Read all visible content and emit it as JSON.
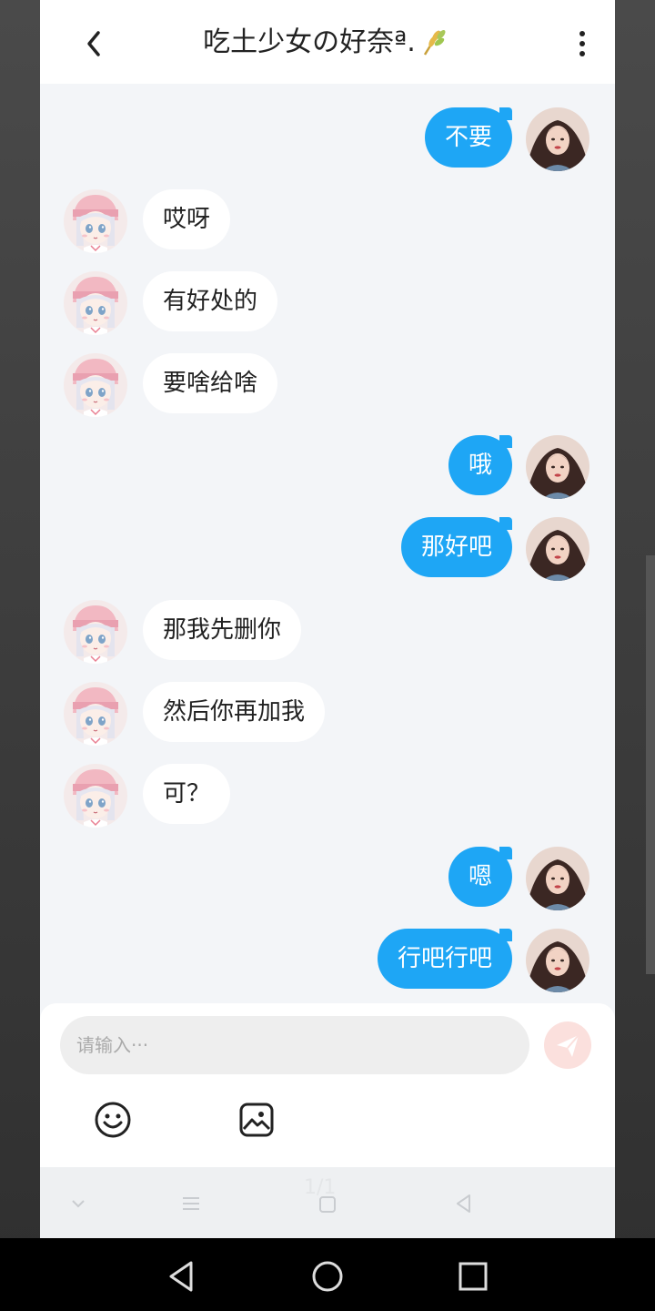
{
  "header": {
    "title": "吃土少女の好奈ª."
  },
  "messages": [
    {
      "side": "right",
      "text": "不要"
    },
    {
      "side": "left",
      "text": "哎呀"
    },
    {
      "side": "left",
      "text": "有好处的"
    },
    {
      "side": "left",
      "text": "要啥给啥"
    },
    {
      "side": "right",
      "text": "哦"
    },
    {
      "side": "right",
      "text": "那好吧"
    },
    {
      "side": "left",
      "text": "那我先删你"
    },
    {
      "side": "left",
      "text": "然后你再加我"
    },
    {
      "side": "left",
      "text": "可？"
    },
    {
      "side": "right",
      "text": "嗯"
    },
    {
      "side": "right",
      "text": "行吧行吧"
    }
  ],
  "composer": {
    "placeholder": "请输入···"
  },
  "toolbar": {
    "page_count": "1/1"
  },
  "icons": {
    "back": "chevron-left-icon",
    "more": "more-vertical-icon",
    "title_decoration": "wheat-icon",
    "send": "paper-plane-icon",
    "emoji": "smiley-icon",
    "image": "image-icon"
  },
  "colors": {
    "outgoing_bubble": "#1ea6f5",
    "incoming_bubble": "#ffffff",
    "chat_background": "#f3f5f8",
    "send_button": "#fbe0dd"
  }
}
